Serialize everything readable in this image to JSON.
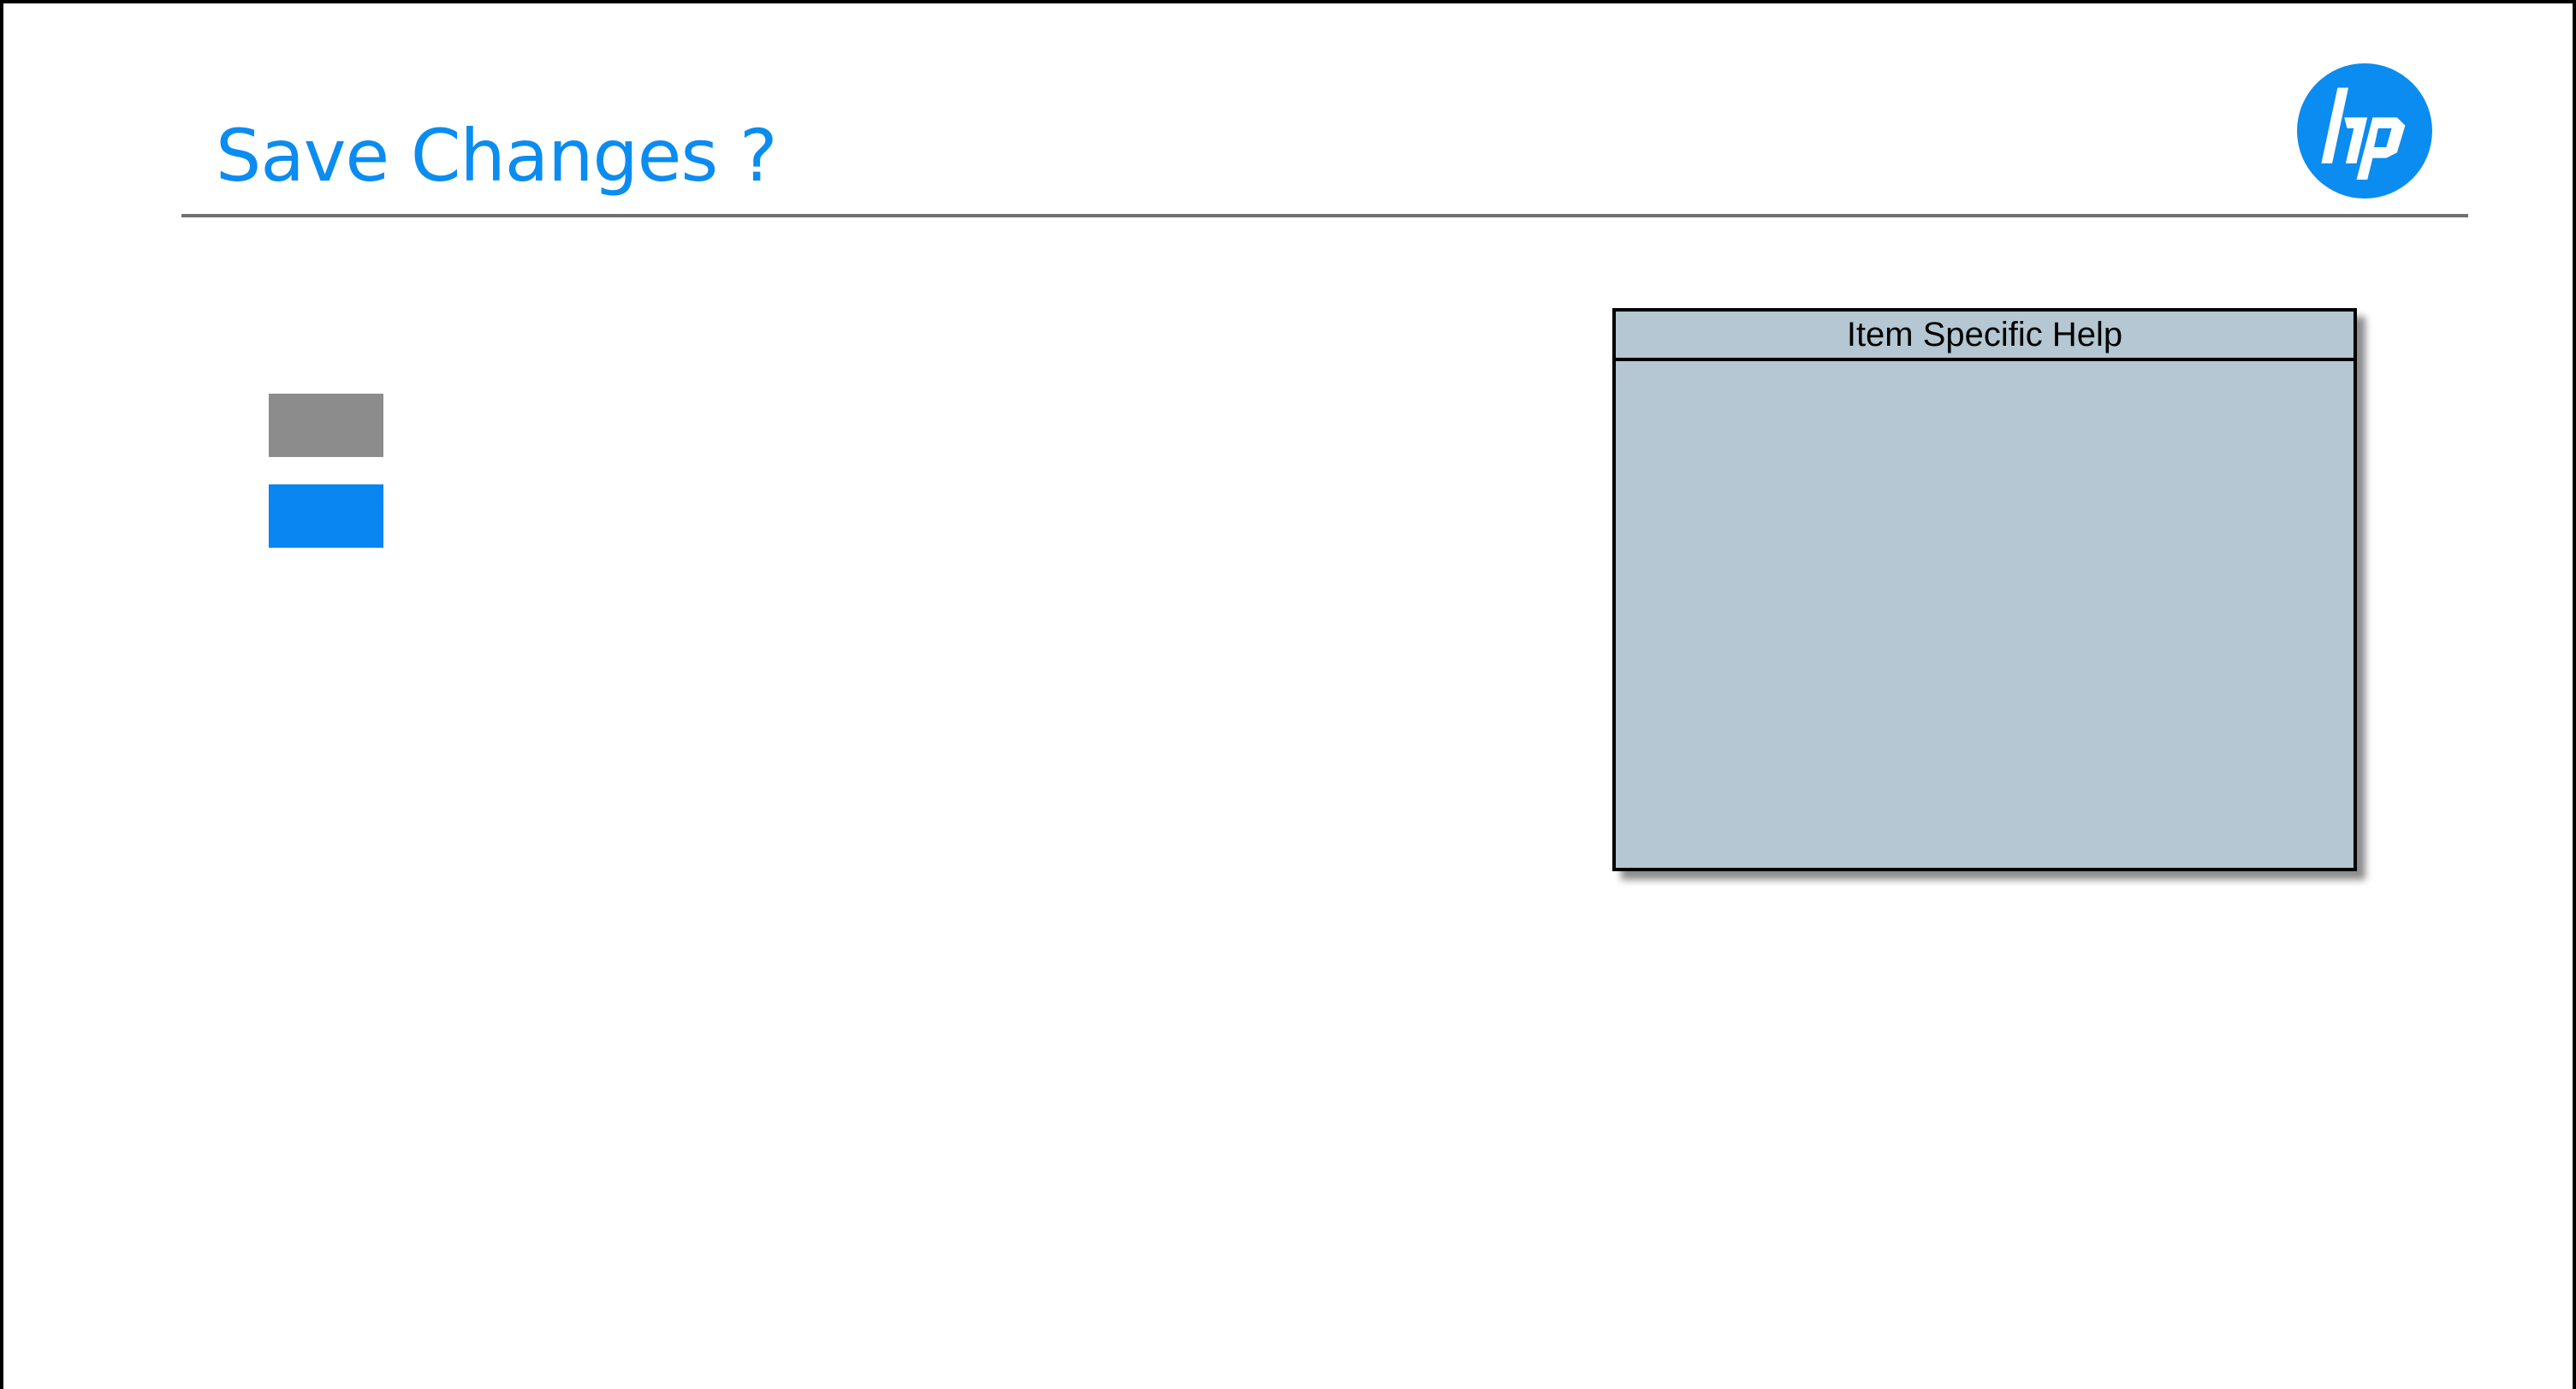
{
  "page": {
    "title": "Save Changes ?"
  },
  "brand": {
    "logo_icon": "hp-logo-icon",
    "logo_text": "hp",
    "accent_color": "#0b8cf0"
  },
  "options": [
    {
      "label": "",
      "state": "unselected",
      "color": "#8c8c8c"
    },
    {
      "label": "",
      "state": "selected",
      "color": "#0a86f2"
    }
  ],
  "help_panel": {
    "header": "Item Specific Help",
    "body": "",
    "background": "#b4c7d2"
  }
}
